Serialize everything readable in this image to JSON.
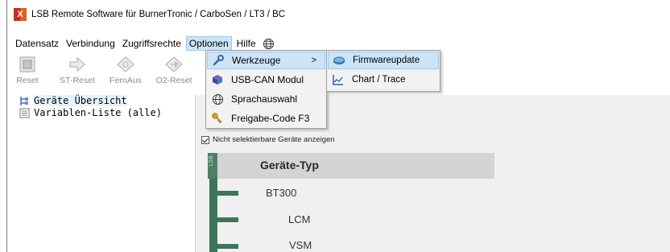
{
  "window": {
    "title": "LSB Remote Software für BurnerTronic / CarboSen / LT3 / BC",
    "icon": "lsb-app-icon"
  },
  "menubar": {
    "items": [
      {
        "label": "Datensatz"
      },
      {
        "label": "Verbindung"
      },
      {
        "label": "Zugriffsrechte"
      },
      {
        "label": "Optionen",
        "active": true
      },
      {
        "label": "Hilfe"
      }
    ],
    "language_icon": "globe-icon"
  },
  "toolbar": {
    "buttons": [
      {
        "label": "Reset",
        "icon": "reset-icon"
      },
      {
        "label": "ST-Reset",
        "icon": "st-reset-arrow-icon"
      },
      {
        "label": "FernAus",
        "icon": "remote-off-icon"
      },
      {
        "label": "O2-Reset",
        "icon": "o2-reset-icon"
      }
    ]
  },
  "tree": {
    "items": [
      {
        "label": "Geräte Übersicht",
        "icon": "device-tree-icon",
        "selected": true
      },
      {
        "label": "Variablen-Liste (alle)",
        "icon": "list-icon"
      }
    ]
  },
  "options_menu": {
    "items": [
      {
        "label": "Werkzeuge",
        "icon": "wrench-icon",
        "has_submenu": true
      },
      {
        "label": "USB-CAN Modul",
        "icon": "usb-can-icon"
      },
      {
        "label": "Sprachauswahl",
        "icon": "globe-icon"
      },
      {
        "label": "Freigabe-Code F3",
        "icon": "key-icon"
      }
    ],
    "submenu_arrow": ">"
  },
  "tools_submenu": {
    "items": [
      {
        "label": "Firmwareupdate",
        "icon": "firmware-icon"
      },
      {
        "label": "Chart / Trace",
        "icon": "chart-icon"
      }
    ]
  },
  "main": {
    "checkbox_label": "Nicht selektierbare Geräte anzeigen",
    "checkbox_checked": true,
    "device_column_header": "Geräte-Typ",
    "bus_label": "LSB",
    "devices": [
      "BT300",
      "LCM",
      "VSM"
    ]
  },
  "colors": {
    "menu_highlight": "#cce4f7",
    "bus_green": "#3e7559",
    "header_gray": "#d4d4d4",
    "title_icon_red": "#cc2a1e"
  }
}
